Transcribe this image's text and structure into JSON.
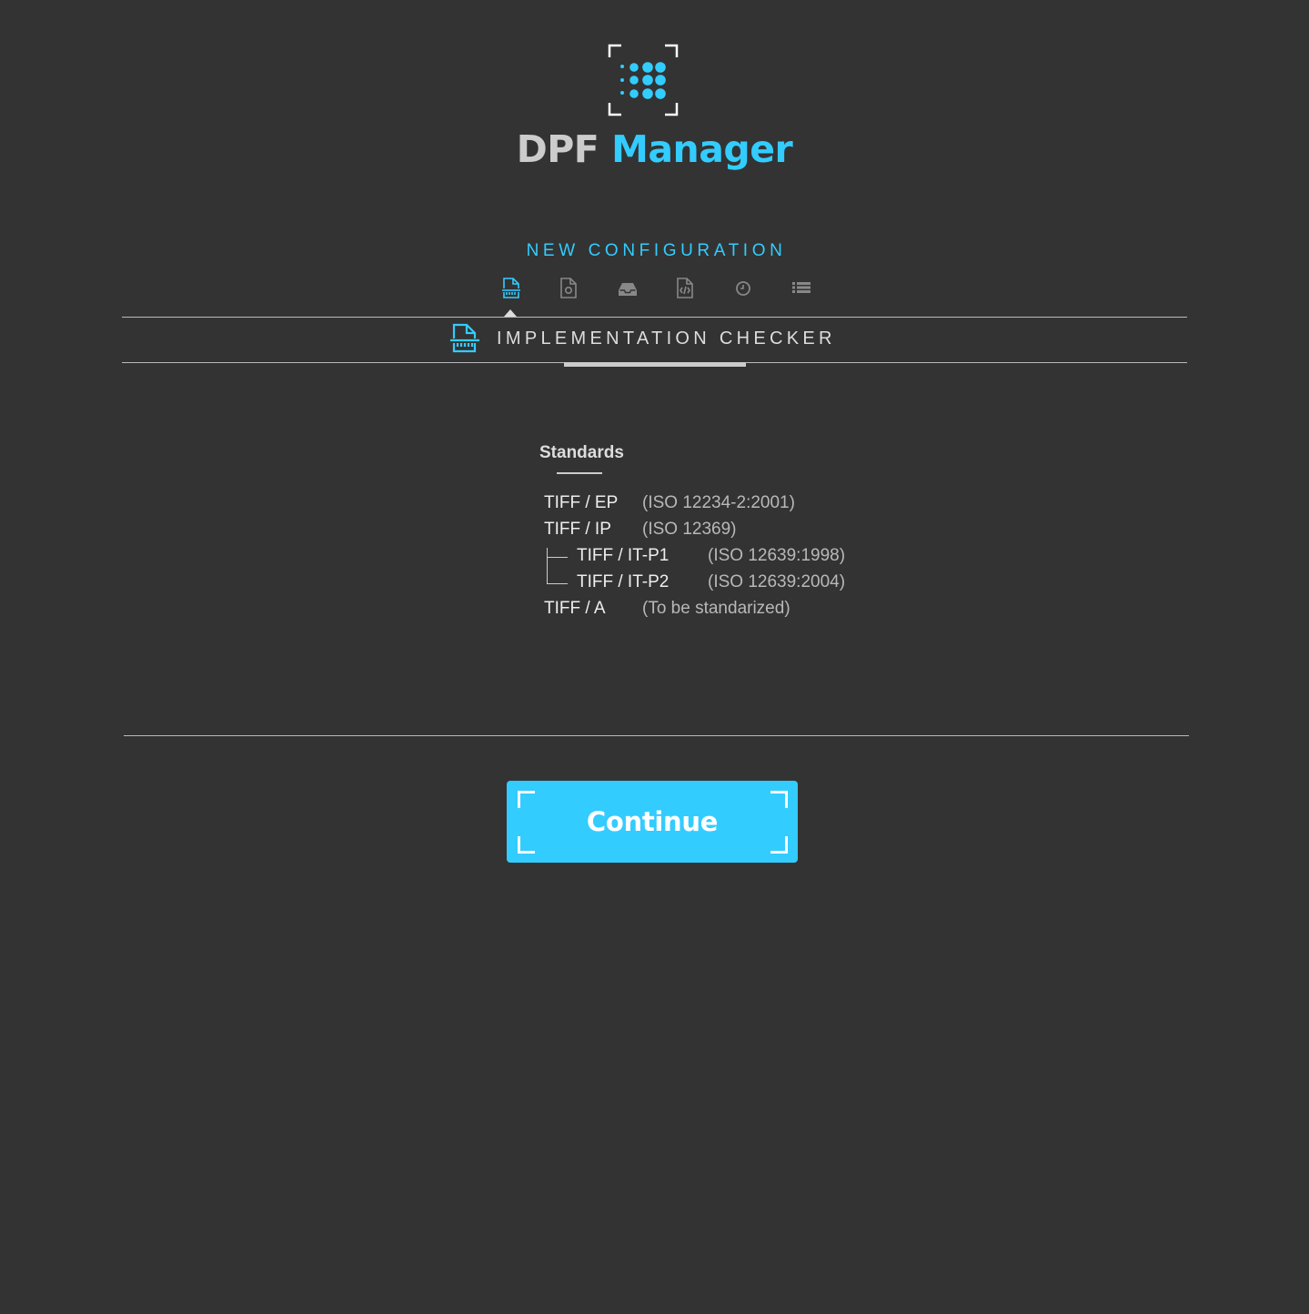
{
  "app": {
    "brand_part1": "DPF",
    "brand_part2": "Manager",
    "accent_color": "#33ccff",
    "background_color": "#333333"
  },
  "wizard": {
    "title": "NEW CONFIGURATION",
    "steps": [
      {
        "icon": "implementation-checker-icon",
        "active": true
      },
      {
        "icon": "policy-rules-icon",
        "active": false
      },
      {
        "icon": "inbox-tray-icon",
        "active": false
      },
      {
        "icon": "code-file-icon",
        "active": false
      },
      {
        "icon": "clock-icon",
        "active": false
      },
      {
        "icon": "list-icon",
        "active": false
      }
    ]
  },
  "section": {
    "icon": "implementation-checker-icon",
    "title": "IMPLEMENTATION CHECKER"
  },
  "standards": {
    "heading": "Standards",
    "items": [
      {
        "name": "TIFF / EP",
        "iso": "(ISO 12234-2:2001)",
        "level": 0
      },
      {
        "name": "TIFF / IP",
        "iso": "(ISO 12369)",
        "level": 0
      },
      {
        "name": "TIFF / IT-P1",
        "iso": "(ISO 12639:1998)",
        "level": 1
      },
      {
        "name": "TIFF / IT-P2",
        "iso": "(ISO 12639:2004)",
        "level": 1
      },
      {
        "name": "TIFF / A",
        "iso": "(To be standarized)",
        "level": 0
      }
    ]
  },
  "actions": {
    "continue_label": "Continue"
  }
}
